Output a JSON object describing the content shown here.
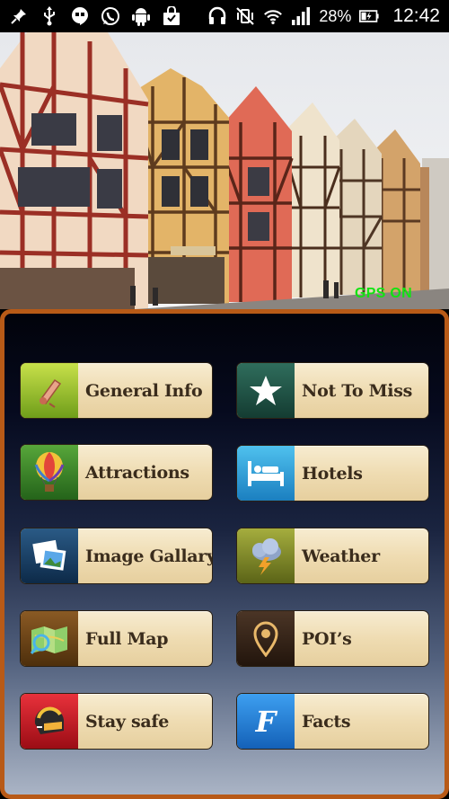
{
  "status_bar": {
    "left_icons": [
      "pin-icon",
      "usb-icon",
      "hangouts-icon",
      "whatsapp-icon",
      "android-icon",
      "shopping-bag-icon"
    ],
    "right_icons": [
      "headset-icon",
      "vibrate-off-icon",
      "wifi-icon",
      "signal-icon"
    ],
    "battery_percent": "28%",
    "time": "12:42"
  },
  "hero": {
    "gps_status": "GPS ON"
  },
  "menu": {
    "items": [
      {
        "label": "General Info",
        "icon": "scroll-icon"
      },
      {
        "label": "Not To Miss",
        "icon": "star-icon"
      },
      {
        "label": "Attractions",
        "icon": "hot-air-balloon-icon"
      },
      {
        "label": "Hotels",
        "icon": "bed-icon"
      },
      {
        "label": "Image Gallary",
        "icon": "photos-icon"
      },
      {
        "label": "Weather",
        "icon": "storm-cloud-icon"
      },
      {
        "label": "Full Map",
        "icon": "map-icon"
      },
      {
        "label": "POI’s",
        "icon": "location-pin-icon"
      },
      {
        "label": "Stay safe",
        "icon": "helmet-icon"
      },
      {
        "label": "Facts",
        "icon": "facts-icon"
      }
    ]
  },
  "colors": {
    "panel_border": "#b85a17",
    "button_face": "#efdcb2",
    "gps_status": "#12e312"
  }
}
